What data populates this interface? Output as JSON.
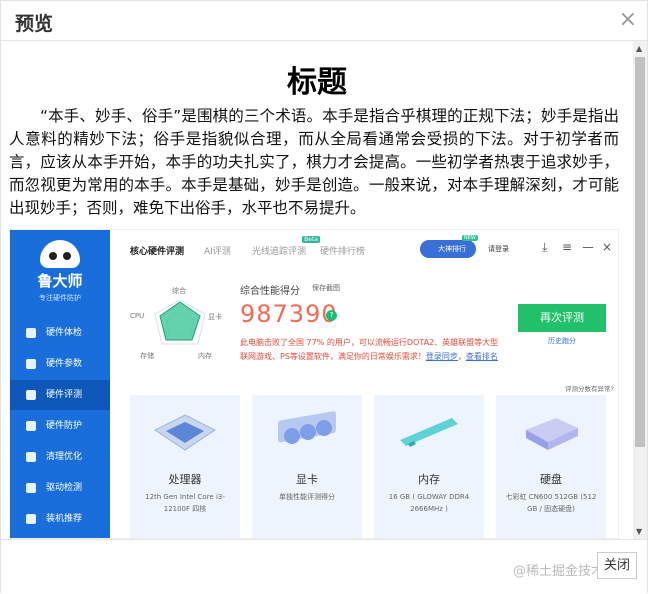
{
  "dialog": {
    "title": "预览",
    "close_icon": "×",
    "close_button": "关闭",
    "watermark": "@稀土掘金技术社区"
  },
  "document": {
    "title": "标题",
    "paragraph": "“本手、妙手、俗手”是围棋的三个术语。本手是指合乎棋理的正规下法；妙手是指出人意料的精妙下法；俗手是指貌似合理，而从全局看通常会受损的下法。对于初学者而言，应该从本手开始，本手的功夫扎实了，棋力才会提高。一些初学者热衷于追求妙手，而忽视更为常用的本手。本手是基础，妙手是创造。一般来说，对本手理解深刻，才可能出现妙手；否则，难免下出俗手，水平也不易提升。"
  },
  "app": {
    "brand": "鲁大师",
    "brand_sub": "专注硬件防护",
    "nav": [
      "硬件体检",
      "硬件参数",
      "硬件评测",
      "硬件防护",
      "清理优化",
      "驱动检测",
      "装机推荐"
    ],
    "active_nav": 2,
    "tabs": [
      "核心硬件评测",
      "AI评测",
      "光线追踪评测",
      "硬件排行榜"
    ],
    "beta": "Beta",
    "vip_label": "大神排行",
    "new_badge": "NEW",
    "login": "请登录",
    "radar_labels": {
      "top": "综合",
      "left": "CPU",
      "right": "显卡",
      "bottom_left": "存储",
      "bottom_right": "内存"
    },
    "score_label": "综合性能得分",
    "save_shot": "保存截图",
    "score": "987390",
    "rank_text": "此电脑击败了全国 77% 的用户，可以流畅运行DOTA2、英雄联盟等大型联网游戏、PS等设置软件，满足你的日常娱乐需求！",
    "rank_link": "查看排名",
    "login_link": "登录同步",
    "retest": "再次评测",
    "history": "历史跑分",
    "abnormal": "评测分数有异常?",
    "cards": [
      {
        "name": "处理器",
        "desc": "12th Gen Intel Core i3-12100F 四核"
      },
      {
        "name": "显卡",
        "desc": "单独性能评测得分"
      },
      {
        "name": "内存",
        "desc": "16 GB ( GLOWAY DDR4 2666MHz )"
      },
      {
        "name": "硬盘",
        "desc": "七彩虹 CN600 512GB (512 GB / 固态硬盘)"
      }
    ]
  },
  "colors": {
    "sidebar": "#1a6edb",
    "score": "#f36b54",
    "retest": "#22c06b",
    "card_bg": "#eef4fd"
  }
}
